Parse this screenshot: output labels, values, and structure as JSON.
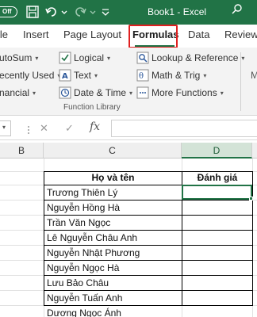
{
  "titlebar": {
    "autosave": "Off",
    "title": "Book1  -  Excel"
  },
  "tabs": [
    {
      "label": "ile"
    },
    {
      "label": "Insert"
    },
    {
      "label": "Page Layout"
    },
    {
      "label": "Formulas"
    },
    {
      "label": "Data"
    },
    {
      "label": "Review"
    }
  ],
  "ribbon": {
    "left_col": [
      "utoSum",
      "ecently Used",
      "nancial"
    ],
    "mid_col": [
      "Logical",
      "Text",
      "Date & Time"
    ],
    "right_col": [
      "Lookup & Reference",
      "Math & Trig",
      "More Functions"
    ],
    "edge_label": "M",
    "group_label": "Function Library"
  },
  "formula_bar": {
    "cancel": "✕",
    "enter": "✓",
    "fx": "fx",
    "value": ""
  },
  "columns": [
    "B",
    "C",
    "D"
  ],
  "table": {
    "headers": [
      "Họ và tên",
      "Đánh giá"
    ],
    "rows": [
      "Trương Thiên Lý",
      "Nguyễn Hồng Hà",
      "Trần Văn Ngọc",
      "Lê Nguyễn Châu Anh",
      "Nguyễn Nhật Phương",
      "Nguyễn Ngọc Hà",
      "Lưu Bảo Châu",
      "Nguyễn Tuấn Anh",
      "Dương Ngọc Ánh"
    ]
  },
  "colors": {
    "excel_green": "#217346",
    "highlight_red": "#e02020"
  }
}
